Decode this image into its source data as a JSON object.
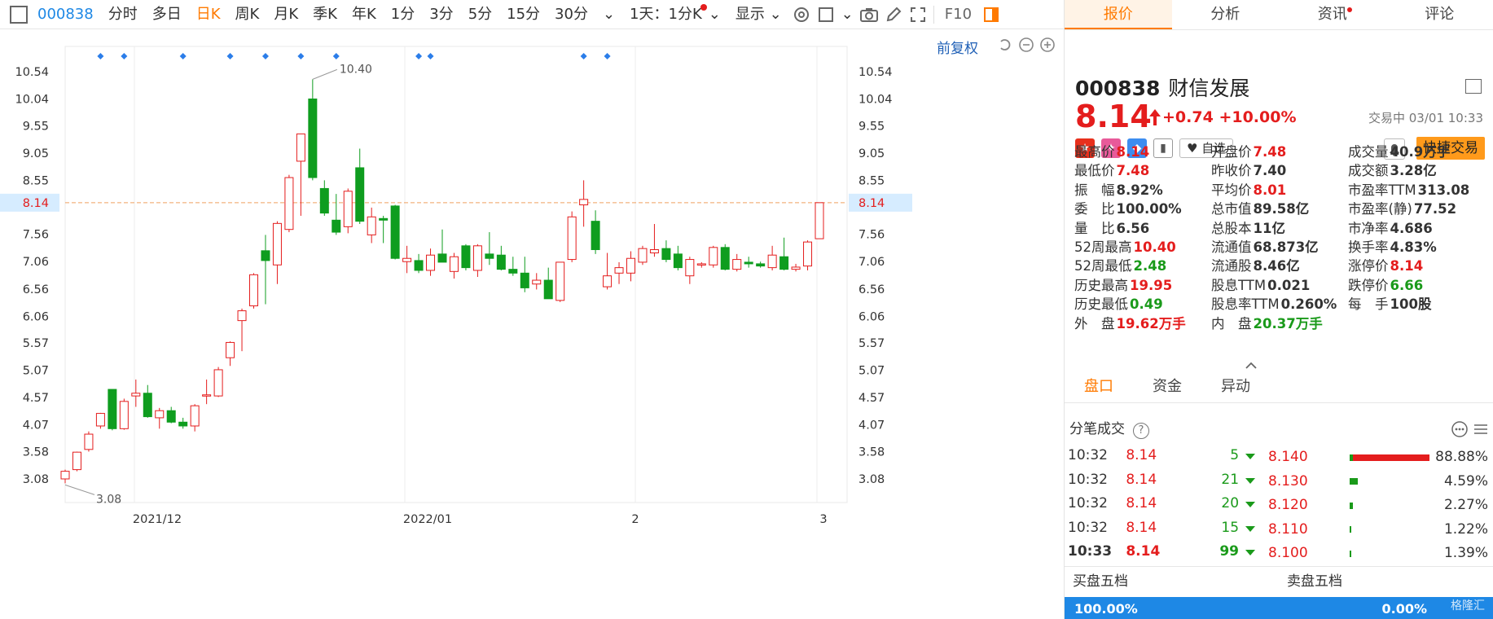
{
  "toolbar": {
    "code": "000838",
    "items": [
      "分时",
      "多日",
      "日K",
      "周K",
      "月K",
      "季K",
      "年K",
      "1分",
      "3分",
      "5分",
      "15分",
      "30分"
    ],
    "active_index": 2,
    "multi_day": "1天：1分K",
    "display": "显示",
    "f10": "F10"
  },
  "chart": {
    "fuquan_label": "前复权",
    "current_price_label": "8.14",
    "high_annotation": "10.40",
    "low_annotation": "3.08",
    "accent_up": "#e41d1d",
    "accent_down": "#0f9d1f"
  },
  "chart_data": {
    "type": "candlestick",
    "y_ticks": [
      "10.54",
      "10.04",
      "9.55",
      "9.05",
      "8.55",
      "8.14",
      "7.56",
      "7.06",
      "6.56",
      "6.06",
      "5.57",
      "5.07",
      "4.57",
      "4.07",
      "3.58",
      "3.08"
    ],
    "x_labels": [
      "2021/12",
      "2022/01",
      "2",
      "3"
    ],
    "ylim": [
      2.6,
      10.8
    ],
    "last_price": 8.14,
    "candles": [
      {
        "o": 3.08,
        "h": 3.25,
        "l": 3.0,
        "c": 3.22
      },
      {
        "o": 3.25,
        "h": 3.58,
        "l": 3.22,
        "c": 3.57
      },
      {
        "o": 3.62,
        "h": 3.95,
        "l": 3.58,
        "c": 3.9
      },
      {
        "o": 4.05,
        "h": 4.29,
        "l": 4.0,
        "c": 4.28
      },
      {
        "o": 4.72,
        "h": 4.72,
        "l": 3.97,
        "c": 4.0
      },
      {
        "o": 4.0,
        "h": 4.55,
        "l": 3.98,
        "c": 4.5
      },
      {
        "o": 4.6,
        "h": 4.9,
        "l": 4.4,
        "c": 4.65
      },
      {
        "o": 4.65,
        "h": 4.8,
        "l": 4.2,
        "c": 4.22
      },
      {
        "o": 4.2,
        "h": 4.38,
        "l": 4.0,
        "c": 4.33
      },
      {
        "o": 4.33,
        "h": 4.4,
        "l": 4.1,
        "c": 4.12
      },
      {
        "o": 4.12,
        "h": 4.2,
        "l": 4.0,
        "c": 4.05
      },
      {
        "o": 4.05,
        "h": 4.45,
        "l": 3.95,
        "c": 4.42
      },
      {
        "o": 4.6,
        "h": 4.9,
        "l": 4.45,
        "c": 4.62
      },
      {
        "o": 4.6,
        "h": 5.13,
        "l": 4.58,
        "c": 5.08
      },
      {
        "o": 5.3,
        "h": 5.6,
        "l": 5.15,
        "c": 5.58
      },
      {
        "o": 5.98,
        "h": 6.2,
        "l": 5.42,
        "c": 6.16
      },
      {
        "o": 6.25,
        "h": 6.85,
        "l": 6.2,
        "c": 6.82
      },
      {
        "o": 7.26,
        "h": 7.55,
        "l": 6.28,
        "c": 7.08
      },
      {
        "o": 7.0,
        "h": 7.8,
        "l": 6.65,
        "c": 7.76
      },
      {
        "o": 7.65,
        "h": 8.65,
        "l": 7.6,
        "c": 8.6
      },
      {
        "o": 8.9,
        "h": 9.4,
        "l": 7.9,
        "c": 9.4
      },
      {
        "o": 10.04,
        "h": 10.4,
        "l": 8.55,
        "c": 8.6
      },
      {
        "o": 8.4,
        "h": 8.55,
        "l": 7.9,
        "c": 7.95
      },
      {
        "o": 7.82,
        "h": 8.3,
        "l": 7.55,
        "c": 7.6
      },
      {
        "o": 7.7,
        "h": 8.4,
        "l": 7.58,
        "c": 8.35
      },
      {
        "o": 8.78,
        "h": 9.13,
        "l": 7.75,
        "c": 7.8
      },
      {
        "o": 7.55,
        "h": 8.05,
        "l": 7.4,
        "c": 7.88
      },
      {
        "o": 7.85,
        "h": 7.9,
        "l": 7.4,
        "c": 7.82
      },
      {
        "o": 8.08,
        "h": 8.1,
        "l": 7.1,
        "c": 7.12
      },
      {
        "o": 7.06,
        "h": 7.35,
        "l": 6.85,
        "c": 7.12
      },
      {
        "o": 7.08,
        "h": 7.2,
        "l": 6.85,
        "c": 6.9
      },
      {
        "o": 6.9,
        "h": 7.3,
        "l": 6.8,
        "c": 7.18
      },
      {
        "o": 7.2,
        "h": 7.65,
        "l": 7.05,
        "c": 7.05
      },
      {
        "o": 6.88,
        "h": 7.22,
        "l": 6.75,
        "c": 7.15
      },
      {
        "o": 7.35,
        "h": 7.38,
        "l": 6.9,
        "c": 6.95
      },
      {
        "o": 6.9,
        "h": 7.38,
        "l": 6.78,
        "c": 7.35
      },
      {
        "o": 7.2,
        "h": 7.6,
        "l": 7.0,
        "c": 7.12
      },
      {
        "o": 7.18,
        "h": 7.35,
        "l": 6.9,
        "c": 6.92
      },
      {
        "o": 6.92,
        "h": 7.15,
        "l": 6.8,
        "c": 6.85
      },
      {
        "o": 6.85,
        "h": 7.15,
        "l": 6.5,
        "c": 6.58
      },
      {
        "o": 6.65,
        "h": 6.85,
        "l": 6.55,
        "c": 6.72
      },
      {
        "o": 6.72,
        "h": 6.95,
        "l": 6.38,
        "c": 6.38
      },
      {
        "o": 6.35,
        "h": 7.05,
        "l": 6.32,
        "c": 7.05
      },
      {
        "o": 7.1,
        "h": 7.98,
        "l": 7.05,
        "c": 7.88
      },
      {
        "o": 8.1,
        "h": 8.55,
        "l": 7.7,
        "c": 8.2
      },
      {
        "o": 7.8,
        "h": 8.0,
        "l": 7.2,
        "c": 7.28
      },
      {
        "o": 6.6,
        "h": 7.22,
        "l": 6.55,
        "c": 6.8
      },
      {
        "o": 6.85,
        "h": 7.05,
        "l": 6.65,
        "c": 6.95
      },
      {
        "o": 6.85,
        "h": 7.25,
        "l": 6.7,
        "c": 7.12
      },
      {
        "o": 7.05,
        "h": 7.35,
        "l": 7.0,
        "c": 7.3
      },
      {
        "o": 7.22,
        "h": 7.75,
        "l": 7.15,
        "c": 7.28
      },
      {
        "o": 7.3,
        "h": 7.45,
        "l": 7.05,
        "c": 7.1
      },
      {
        "o": 7.2,
        "h": 7.35,
        "l": 6.9,
        "c": 6.95
      },
      {
        "o": 6.8,
        "h": 7.15,
        "l": 6.65,
        "c": 7.1
      },
      {
        "o": 7.02,
        "h": 7.05,
        "l": 6.95,
        "c": 7.02
      },
      {
        "o": 7.0,
        "h": 7.35,
        "l": 6.95,
        "c": 7.32
      },
      {
        "o": 7.32,
        "h": 7.38,
        "l": 6.9,
        "c": 6.92
      },
      {
        "o": 6.92,
        "h": 7.2,
        "l": 6.88,
        "c": 7.1
      },
      {
        "o": 7.05,
        "h": 7.15,
        "l": 6.95,
        "c": 7.02
      },
      {
        "o": 7.02,
        "h": 7.06,
        "l": 6.95,
        "c": 6.98
      },
      {
        "o": 6.95,
        "h": 7.35,
        "l": 6.9,
        "c": 7.18
      },
      {
        "o": 7.15,
        "h": 7.5,
        "l": 6.9,
        "c": 6.92
      },
      {
        "o": 6.92,
        "h": 7.02,
        "l": 6.88,
        "c": 6.96
      },
      {
        "o": 6.98,
        "h": 7.45,
        "l": 6.9,
        "c": 7.42
      },
      {
        "o": 7.48,
        "h": 8.14,
        "l": 7.48,
        "c": 8.14
      }
    ],
    "event_markers": [
      3,
      5,
      10,
      14,
      17,
      20,
      23,
      30,
      31,
      44,
      46
    ]
  },
  "panel": {
    "tabs": [
      "报价",
      "分析",
      "资讯",
      "评论"
    ],
    "code": "000838",
    "name": "财信发展",
    "price": "8.14",
    "change": "+0.74",
    "change_pct": "+10.00%",
    "trade_time": "交易中 03/01 10:33",
    "zixuan": "自选",
    "quick_trade": "快捷交易",
    "quote_rows": [
      [
        {
          "l": "最高价",
          "v": "8.14",
          "c": "up"
        },
        {
          "l": "开盘价",
          "v": "7.48",
          "c": "up"
        },
        {
          "l": "成交量",
          "v": "40.9万手",
          "c": "nt"
        }
      ],
      [
        {
          "l": "最低价",
          "v": "7.48",
          "c": "up"
        },
        {
          "l": "昨收价",
          "v": "7.40",
          "c": "nt"
        },
        {
          "l": "成交额",
          "v": "3.28亿",
          "c": "nt"
        }
      ],
      [
        {
          "l": "振　幅",
          "v": "8.92%",
          "c": "nt"
        },
        {
          "l": "平均价",
          "v": "8.01",
          "c": "up"
        },
        {
          "l": "市盈率TTM",
          "v": "313.08",
          "c": "nt"
        }
      ],
      [
        {
          "l": "委　比",
          "v": "100.00%",
          "c": "nt"
        },
        {
          "l": "总市值",
          "v": "89.58亿",
          "c": "nt"
        },
        {
          "l": "市盈率(静)",
          "v": "77.52",
          "c": "nt"
        }
      ],
      [
        {
          "l": "量　比",
          "v": "6.56",
          "c": "nt"
        },
        {
          "l": "总股本",
          "v": "11亿",
          "c": "nt"
        },
        {
          "l": "市净率",
          "v": "4.686",
          "c": "nt"
        }
      ],
      [
        {
          "l": "52周最高",
          "v": "10.40",
          "c": "up"
        },
        {
          "l": "流通值",
          "v": "68.873亿",
          "c": "nt"
        },
        {
          "l": "换手率",
          "v": "4.83%",
          "c": "nt"
        }
      ],
      [
        {
          "l": "52周最低",
          "v": "2.48",
          "c": "dn"
        },
        {
          "l": "流通股",
          "v": "8.46亿",
          "c": "nt"
        },
        {
          "l": "涨停价",
          "v": "8.14",
          "c": "up"
        }
      ],
      [
        {
          "l": "历史最高",
          "v": "19.95",
          "c": "up"
        },
        {
          "l": "股息TTM",
          "v": "0.021",
          "c": "nt"
        },
        {
          "l": "跌停价",
          "v": "6.66",
          "c": "dn"
        }
      ],
      [
        {
          "l": "历史最低",
          "v": "0.49",
          "c": "dn"
        },
        {
          "l": "股息率TTM",
          "v": "0.260%",
          "c": "nt"
        },
        {
          "l": "每　手",
          "v": "100股",
          "c": "nt"
        }
      ],
      [
        {
          "l": "外　盘",
          "v": "19.62万手",
          "c": "up"
        },
        {
          "l": "内　盘",
          "v": "20.37万手",
          "c": "dn"
        },
        {
          "l": "",
          "v": "",
          "c": "nt"
        }
      ]
    ],
    "sub_tabs": [
      "盘口",
      "资金",
      "异动"
    ],
    "ticks_title": "分笔成交",
    "ticks": [
      {
        "t": "10:32",
        "p": "8.14",
        "v": "5"
      },
      {
        "t": "10:32",
        "p": "8.14",
        "v": "21"
      },
      {
        "t": "10:32",
        "p": "8.14",
        "v": "20"
      },
      {
        "t": "10:32",
        "p": "8.14",
        "v": "15"
      },
      {
        "t": "10:33",
        "p": "8.14",
        "v": "99"
      }
    ],
    "distribution": [
      {
        "p": "8.140",
        "pct": "88.88%",
        "frac": 0.98
      },
      {
        "p": "8.130",
        "pct": "4.59%",
        "frac": 0.1
      },
      {
        "p": "8.120",
        "pct": "2.27%",
        "frac": 0.04
      },
      {
        "p": "8.110",
        "pct": "1.22%",
        "frac": 0.02
      },
      {
        "p": "8.100",
        "pct": "1.39%",
        "frac": 0.02
      }
    ],
    "buy5": "买盘五档",
    "sell5": "卖盘五档",
    "buy_pct": "100.00%",
    "sell_pct": "0.00%",
    "watermark": "格隆汇"
  }
}
